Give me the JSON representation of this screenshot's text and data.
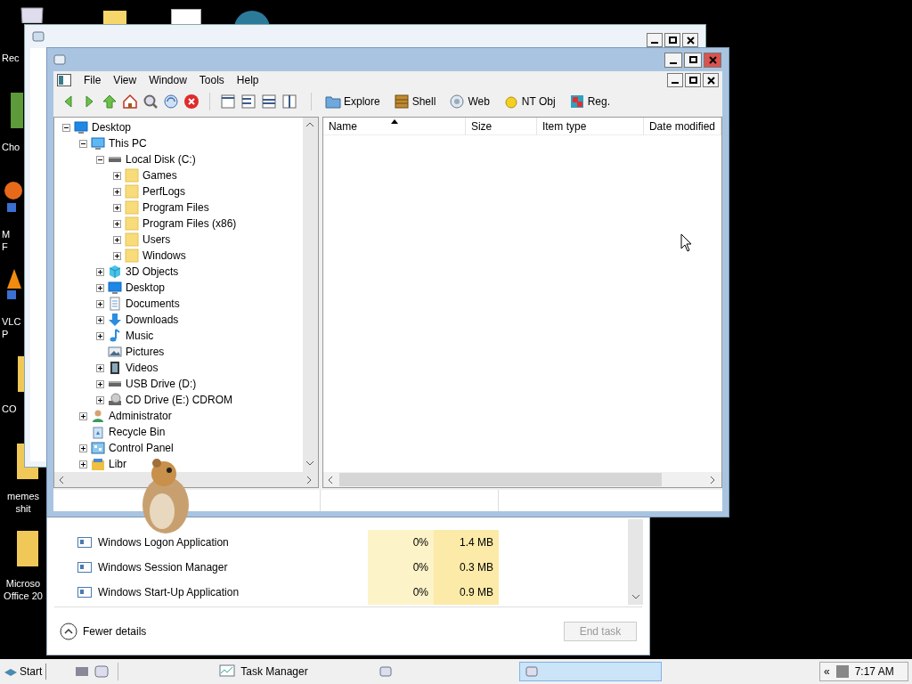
{
  "desktop_icons": [
    {
      "kind": "recycle",
      "lines": [
        "Rec"
      ]
    },
    {
      "kind": "app",
      "lines": [
        "Cho"
      ]
    },
    {
      "kind": "browser",
      "lines": [
        "M",
        "F"
      ]
    },
    {
      "kind": "media",
      "lines": [
        "VLC",
        "P"
      ]
    },
    {
      "kind": "folder",
      "lines": [
        "CO"
      ]
    },
    {
      "kind": "folder",
      "lines": [
        "memes",
        "shit"
      ]
    },
    {
      "kind": "folder",
      "lines": [
        "Microso",
        "Office 20"
      ]
    }
  ],
  "explorer": {
    "menu": [
      "File",
      "View",
      "Window",
      "Tools",
      "Help"
    ],
    "toolbar_labeled": [
      {
        "kind": "explore",
        "label": "Explore"
      },
      {
        "kind": "shell",
        "label": "Shell"
      },
      {
        "kind": "web",
        "label": "Web"
      },
      {
        "kind": "ntobj",
        "label": "NT Obj"
      },
      {
        "kind": "reg",
        "label": "Reg."
      }
    ],
    "tree": [
      {
        "label": "Desktop",
        "kind": "desktop",
        "expanded": true,
        "children": [
          {
            "label": "This PC",
            "kind": "pc",
            "expanded": true,
            "children": [
              {
                "label": "Local Disk (C:)",
                "kind": "drive",
                "expanded": true,
                "children": [
                  {
                    "label": "Games",
                    "kind": "folder",
                    "expanded": false
                  },
                  {
                    "label": "PerfLogs",
                    "kind": "folder",
                    "expanded": false
                  },
                  {
                    "label": "Program Files",
                    "kind": "folder",
                    "expanded": false
                  },
                  {
                    "label": "Program Files (x86)",
                    "kind": "folder",
                    "expanded": false
                  },
                  {
                    "label": "Users",
                    "kind": "folder",
                    "expanded": false
                  },
                  {
                    "label": "Windows",
                    "kind": "folder",
                    "expanded": false
                  }
                ]
              },
              {
                "label": "3D Objects",
                "kind": "objects",
                "expanded": false
              },
              {
                "label": "Desktop",
                "kind": "desktop",
                "expanded": false
              },
              {
                "label": "Documents",
                "kind": "documents",
                "expanded": false
              },
              {
                "label": "Downloads",
                "kind": "downloads",
                "expanded": false
              },
              {
                "label": "Music",
                "kind": "music",
                "expanded": false
              },
              {
                "label": "Pictures",
                "kind": "pictures"
              },
              {
                "label": "Videos",
                "kind": "videos",
                "expanded": false
              },
              {
                "label": "USB Drive (D:)",
                "kind": "drive",
                "expanded": false
              },
              {
                "label": "CD Drive (E:) CDROM",
                "kind": "cdrom",
                "expanded": false
              }
            ]
          },
          {
            "label": "Administrator",
            "kind": "user",
            "expanded": false
          },
          {
            "label": "Recycle Bin",
            "kind": "recycle"
          },
          {
            "label": "Control Panel",
            "kind": "control",
            "expanded": false
          },
          {
            "label": "Libr",
            "kind": "library",
            "expanded": false
          }
        ]
      }
    ],
    "columns": [
      {
        "label": "Name",
        "sorted": true
      },
      {
        "label": "Size",
        "sorted": false
      },
      {
        "label": "Item type",
        "sorted": false
      },
      {
        "label": "Date modified",
        "sorted": false
      }
    ]
  },
  "task_manager": {
    "rows": [
      {
        "name": "Windows Logon Application",
        "cpu": "0%",
        "memory": "1.4 MB"
      },
      {
        "name": "Windows Session Manager",
        "cpu": "0%",
        "memory": "0.3 MB"
      },
      {
        "name": "Windows Start-Up Application",
        "cpu": "0%",
        "memory": "0.9 MB"
      }
    ],
    "details_toggle": "Fewer details",
    "end_task": {
      "label": "End task",
      "disabled": true
    }
  },
  "taskbar": {
    "start": "Start",
    "buttons": [
      {
        "label": "Task Manager",
        "selected": false
      },
      {
        "selected": false
      },
      {
        "selected": true
      }
    ],
    "tray_toggle": "«",
    "clock": "7:17 AM"
  }
}
